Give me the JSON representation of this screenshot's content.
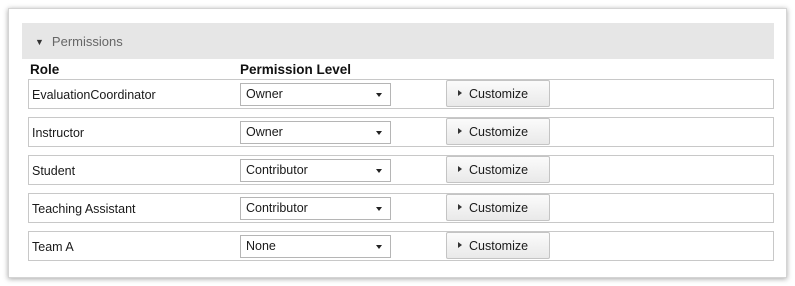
{
  "section": {
    "title": "Permissions",
    "toggle_icon": "triangle-down-icon"
  },
  "columns": {
    "role": "Role",
    "level": "Permission Level"
  },
  "rows": [
    {
      "role": "EvaluationCoordinator",
      "level": "Owner",
      "button": "Customize"
    },
    {
      "role": "Instructor",
      "level": "Owner",
      "button": "Customize"
    },
    {
      "role": "Student",
      "level": "Contributor",
      "button": "Customize"
    },
    {
      "role": "Teaching Assistant",
      "level": "Contributor",
      "button": "Customize"
    },
    {
      "role": "Team A",
      "level": "None",
      "button": "Customize"
    }
  ],
  "colors": {
    "header_bg": "#e6e6e6",
    "header_text": "#666666",
    "row_border": "#c8c8c8"
  }
}
